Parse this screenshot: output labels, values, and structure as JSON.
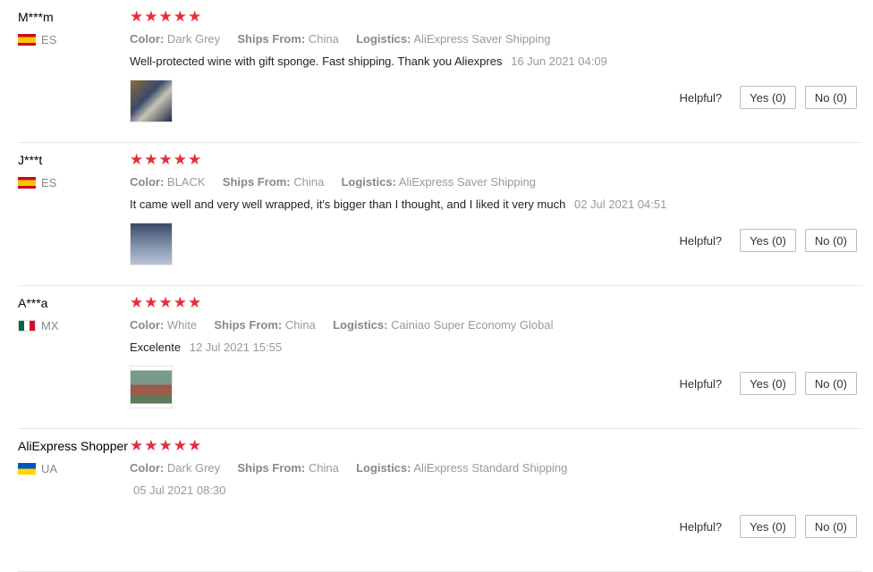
{
  "reviews": [
    {
      "user": "M***m",
      "country": "ES",
      "flag_icon": "flag-es",
      "stars": "★★★★★",
      "rating": 5,
      "color_key": "Color:",
      "color": "Dark Grey",
      "ships_key": "Ships From:",
      "ships": "China",
      "logistics_key": "Logistics:",
      "logistics": "AliExpress Saver Shipping",
      "text": "Well-protected wine with gift sponge. Fast shipping. Thank you Aliexpres",
      "date": "16 Jun 2021 04:09",
      "helpful_label": "Helpful?",
      "yes": "Yes (0)",
      "no": "No (0)"
    },
    {
      "user": "J***t",
      "country": "ES",
      "flag_icon": "flag-es",
      "stars": "★★★★★",
      "rating": 5,
      "color_key": "Color:",
      "color": "BLACK",
      "ships_key": "Ships From:",
      "ships": "China",
      "logistics_key": "Logistics:",
      "logistics": "AliExpress Saver Shipping",
      "text": "It came well and very well wrapped, it's bigger than I thought, and I liked it very much",
      "date": "02 Jul 2021 04:51",
      "helpful_label": "Helpful?",
      "yes": "Yes (0)",
      "no": "No (0)"
    },
    {
      "user": "A***a",
      "country": "MX",
      "flag_icon": "flag-mx",
      "stars": "★★★★★",
      "rating": 5,
      "color_key": "Color:",
      "color": "White",
      "ships_key": "Ships From:",
      "ships": "China",
      "logistics_key": "Logistics:",
      "logistics": "Cainiao Super Economy Global",
      "text": "Excelente",
      "date": "12 Jul 2021 15:55",
      "helpful_label": "Helpful?",
      "yes": "Yes (0)",
      "no": "No (0)"
    },
    {
      "user": "AliExpress Shopper",
      "country": "UA",
      "flag_icon": "flag-ua",
      "stars": "★★★★★",
      "rating": 5,
      "color_key": "Color:",
      "color": "Dark Grey",
      "ships_key": "Ships From:",
      "ships": "China",
      "logistics_key": "Logistics:",
      "logistics": "AliExpress Standard Shipping",
      "text": "",
      "date": "05 Jul 2021 08:30",
      "helpful_label": "Helpful?",
      "yes": "Yes (0)",
      "no": "No (0)"
    }
  ],
  "colors": {
    "star": "#e62e3b",
    "meta_text": "#999999",
    "divider": "#e8e8e8"
  }
}
